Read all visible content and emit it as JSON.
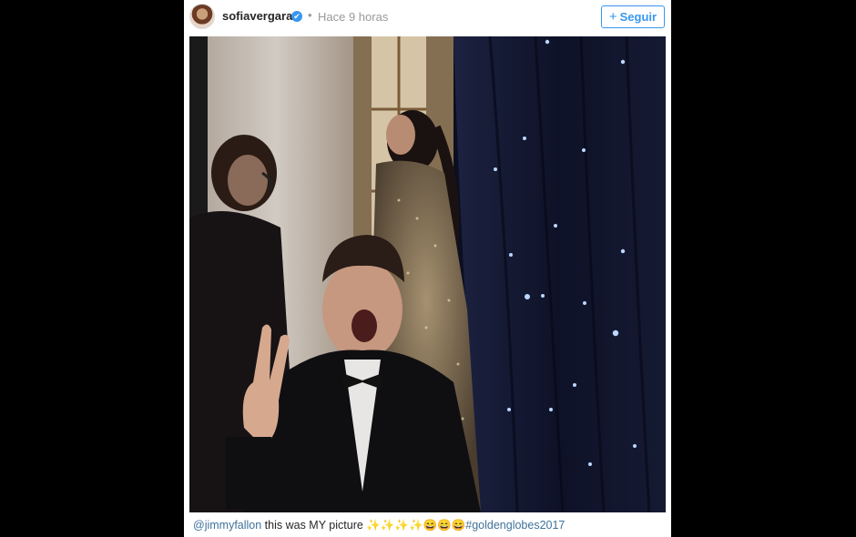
{
  "post": {
    "username": "sofiavergara",
    "verified_glyph": "✔",
    "separator": "•",
    "timestamp": "Hace 9 horas",
    "follow_plus": "+",
    "follow_label": "Seguir"
  },
  "caption": {
    "mention": "@jimmyfallon",
    "text": " this was MY picture ✨✨✨✨😄😄😄",
    "hashtag": "#goldenglobes2017"
  },
  "icons": {
    "avatar": "profile-avatar",
    "verified": "verified-badge-icon"
  },
  "colors": {
    "link": "#3f729b",
    "accent": "#3897f0",
    "frame_background": "#000000"
  }
}
